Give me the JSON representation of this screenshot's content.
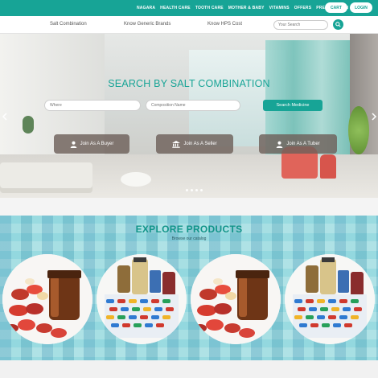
{
  "topnav": {
    "links": [
      "Nagara",
      "Health Care",
      "Tooth Care",
      "Mother & Baby",
      "Vitamins",
      "Offers",
      "Prescription"
    ],
    "cart_label": "CART",
    "login_label": "LOGIN"
  },
  "subnav": {
    "links": [
      "Salt Combination",
      "Know Generic Brands",
      "Know HPS Cost"
    ],
    "search_placeholder": "Your Search"
  },
  "hero": {
    "title": "SEARCH BY SALT COMBINATION",
    "location_placeholder": "Where",
    "composition_placeholder": "Composition Name",
    "search_button": "Search Medicine",
    "join_buyer": "Join As A Buyer",
    "join_seller": "Join As A Seller",
    "join_tuber": "Join As A Tuber",
    "slide_count": 4
  },
  "explore": {
    "title": "EXPLORE PRODUCTS",
    "subtitle": "Browse our catalog"
  },
  "colors": {
    "brand_teal": "#17a496",
    "join_button": "#6e605a"
  },
  "icons": [
    "search-icon",
    "user-icon",
    "bank-icon",
    "chevron-left-icon",
    "chevron-right-icon"
  ]
}
